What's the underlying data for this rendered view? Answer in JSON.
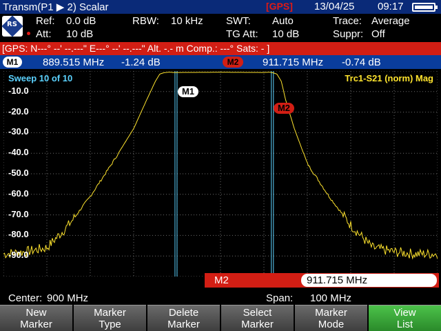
{
  "header": {
    "title": "Transm(P1 ▶ 2) Scalar",
    "gps_indicator": "[GPS]",
    "date": "13/04/25",
    "time": "09:17",
    "battery_level": 1.0
  },
  "settings": {
    "ref_label": "Ref:",
    "ref_value": "0.0 dB",
    "att_label": "Att:",
    "att_value": "10 dB",
    "rbw_label": "RBW:",
    "rbw_value": "10 kHz",
    "swt_label": "SWT:",
    "swt_value": "Auto",
    "tgatt_label": "TG Att:",
    "tgatt_value": "10 dB",
    "trace_label": "Trace:",
    "trace_value": "Average",
    "suppr_label": "Suppr:",
    "suppr_value": "Off",
    "logo_text": "RS"
  },
  "gps_bar": "[GPS:  N---° --' --.---\"    E---° --' --.---\"    Alt. -.-  m   Comp.: ---°  Sats: - ]",
  "markers": {
    "m1": {
      "label": "M1",
      "freq": "889.515 MHz",
      "level": "-1.24 dB"
    },
    "m2": {
      "label": "M2",
      "freq": "911.715 MHz",
      "level": "-0.74 dB"
    }
  },
  "plot": {
    "sweep_label": "Sweep 10 of 10",
    "trace_label": "Trc1-S21 (norm) Mag",
    "y_labels": [
      "-10.0",
      "-20.0",
      "-30.0",
      "-40.0",
      "-50.0",
      "-60.0",
      "-70.0",
      "-80.0",
      "-90.0"
    ],
    "trace_color": "#ffe42e",
    "marker_line_color": "#5bd2ff"
  },
  "chart_data": {
    "type": "line",
    "series": [
      {
        "x": [
          850,
          855,
          860,
          865,
          870,
          875,
          880,
          883,
          885,
          886,
          887,
          888,
          888.5,
          889,
          890,
          900,
          910,
          911,
          911.5,
          912,
          913,
          914,
          915,
          917,
          920,
          925,
          930,
          935,
          940,
          945,
          950
        ],
        "values": [
          -89,
          -88,
          -86,
          -75,
          -61,
          -45,
          -28,
          -14,
          -5,
          -1.5,
          -0.8,
          -0.6,
          -0.6,
          -0.7,
          -0.7,
          -0.6,
          -0.7,
          -0.6,
          -0.6,
          -0.8,
          -1.5,
          -5,
          -14,
          -28,
          -45,
          -61,
          -75,
          -86,
          -88,
          -89,
          -89
        ]
      }
    ],
    "ylim": [
      -100,
      0
    ],
    "xlim": [
      850,
      950
    ],
    "marker_m1_x": 889.515,
    "marker_m2_x": 911.715
  },
  "edit_bar": {
    "name": "M2",
    "value": "911.715 MHz"
  },
  "status": {
    "center_label": "Center:",
    "center_value": "900 MHz",
    "span_label": "Span:",
    "span_value": "100 MHz"
  },
  "softkeys": [
    {
      "line1": "New",
      "line2": "Marker"
    },
    {
      "line1": "Marker",
      "line2": "Type"
    },
    {
      "line1": "Delete",
      "line2": "Marker"
    },
    {
      "line1": "Select",
      "line2": "Marker"
    },
    {
      "line1": "Marker",
      "line2": "Mode"
    },
    {
      "line1": "View",
      "line2": "List"
    }
  ]
}
